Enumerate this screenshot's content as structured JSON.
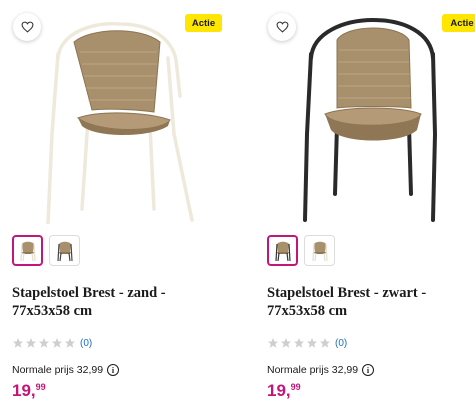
{
  "products": [
    {
      "badge": "Actie",
      "title_line1": "Stapelstoel Brest - zand -",
      "title_line2": "77x53x58 cm",
      "rating_count": "(0)",
      "normal_price_label": "Normale prijs 32,99",
      "price_euros": "19,",
      "price_cents": "99",
      "frame_color": "#efe9dc",
      "icons": {
        "favorite": "heart-icon",
        "info": "info-icon",
        "star": "star-icon"
      }
    },
    {
      "badge": "Actie",
      "title_line1": "Stapelstoel Brest - zwart -",
      "title_line2": "77x53x58 cm",
      "rating_count": "(0)",
      "normal_price_label": "Normale prijs 32,99",
      "price_euros": "19,",
      "price_cents": "99",
      "frame_color": "#2a2a2a",
      "icons": {
        "favorite": "heart-icon",
        "info": "info-icon",
        "star": "star-icon"
      }
    }
  ],
  "colors": {
    "accent": "#c4167a",
    "badge_bg": "#ffe600",
    "rattan": "#a9906c",
    "star_empty": "#cfcfcf",
    "link": "#1a6fc4"
  }
}
